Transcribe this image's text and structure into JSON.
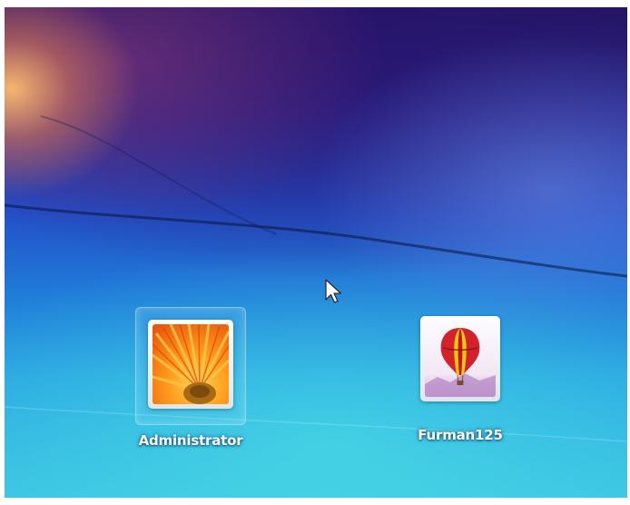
{
  "screen": {
    "name": "Windows 7 logon screen"
  },
  "users": [
    {
      "name": "Administrator",
      "picture": "orange-flower-icon",
      "selected": true
    },
    {
      "name": "Furman125",
      "picture": "hot-air-balloon-icon",
      "selected": false
    }
  ],
  "cursor": {
    "icon": "arrow-cursor-icon"
  },
  "colors": {
    "background_top": "#23155e",
    "background_mid": "#2450c8",
    "background_bottom": "#3cc3e3",
    "label_text": "#ffffff"
  }
}
